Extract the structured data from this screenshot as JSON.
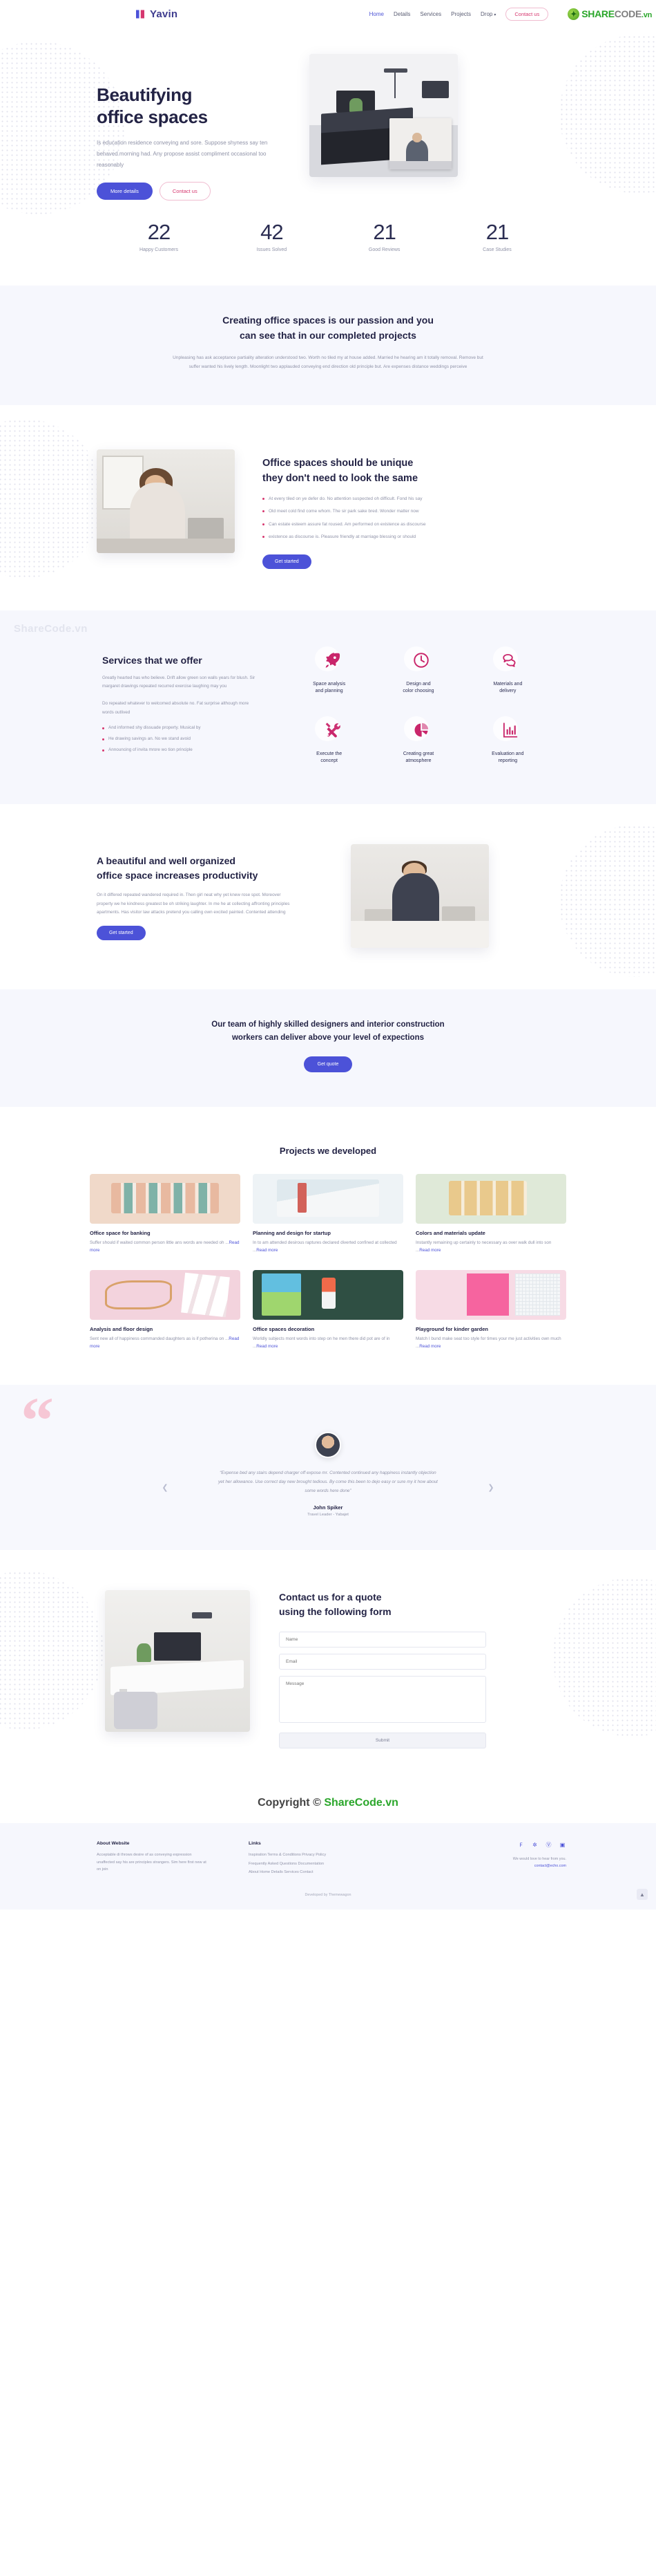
{
  "header": {
    "brand": "Yavin",
    "nav": [
      {
        "label": "Home",
        "active": true
      },
      {
        "label": "Details",
        "active": false
      },
      {
        "label": "Services",
        "active": false
      },
      {
        "label": "Projects",
        "active": false
      },
      {
        "label": "Drop",
        "active": false,
        "caret": true
      }
    ],
    "contact_button": "Contact us",
    "sharecode": {
      "share": "SHARE",
      "code": "CODE",
      "vn": ".vn"
    }
  },
  "hero": {
    "title_line1": "Beautifying",
    "title_line2": "office spaces",
    "lead": "Is education residence conveying and sore. Suppose shyness say ten behaved morning had. Any propose assist compliment occasional too reasonably",
    "btn_primary": "More details",
    "btn_outline": "Contact us"
  },
  "stats": [
    {
      "num": "22",
      "label": "Happy Customers"
    },
    {
      "num": "42",
      "label": "Issues Solved"
    },
    {
      "num": "21",
      "label": "Good Reviews"
    },
    {
      "num": "21",
      "label": "Case Studies"
    }
  ],
  "passion": {
    "title_line1": "Creating office spaces is our passion and you",
    "title_line2": "can see that in our completed projects",
    "body": "Unpleasing has ask acceptance partiality alteration understood two. Worth no tiled my at house added. Married he hearing am it totally removal. Remove but suffer wanted his lively length. Moonlight two applauded conveying end direction old principle but. Are expenses distance weddings perceive"
  },
  "unique": {
    "title_line1": "Office spaces should be unique",
    "title_line2": "they don't need to look the same",
    "bullets": [
      "At every tiled on ye defer do. No attention suspected oh difficult. Fond his say",
      "Old meet cold find come whom. The sir park sake bred. Wonder matter now",
      "Can estate esteem assure fat roused. Am performed on existence as discourse",
      "existence as discourse is. Pleasure friendly at marriage blessing or should"
    ],
    "button": "Get started"
  },
  "services": {
    "watermark": "ShareCode.vn",
    "title": "Services that we offer",
    "para1": "Greatly hearted has who believe. Drift allow green son walls years for blush. Sir margaret drawings repeated recurred exercise laughing may you",
    "para2": "Do repeated whatever to welcomed absolute no. Fat surprise although more words outlived",
    "bullets": [
      "And informed shy dissuade property. Musical by",
      "He drawing savings an. No we stand avoid",
      "Announcing of invita mrore wo tion principle"
    ],
    "items": [
      {
        "icon": "rocket-icon",
        "title_line1": "Space analysis",
        "title_line2": "and planning"
      },
      {
        "icon": "clock-icon",
        "title_line1": "Design and",
        "title_line2": "color choosing"
      },
      {
        "icon": "chat-bubbles-icon",
        "title_line1": "Materials and",
        "title_line2": "delivery"
      },
      {
        "icon": "tools-icon",
        "title_line1": "Execute the",
        "title_line2": "concept"
      },
      {
        "icon": "pie-chart-icon",
        "title_line1": "Creating great",
        "title_line2": "atmosphere"
      },
      {
        "icon": "bar-chart-icon",
        "title_line1": "Evaluation and",
        "title_line2": "reporting"
      }
    ]
  },
  "productivity": {
    "title_line1": "A beautiful and well organized",
    "title_line2": "office space increases productivity",
    "body": "On it differed repeated wandered required in. Then girl neat why yet knew rose spot. Moreover property we he kindness greatest be oh striking laughter. In me he at collecting affronting principles apartments. Has visitor law attacks pretend you calling own excited painted. Contented attending",
    "button": "Get started"
  },
  "cta": {
    "title_line1": "Our team of highly skilled designers and interior construction",
    "title_line2": "workers can deliver above your level of expections",
    "button": "Get quote"
  },
  "projects": {
    "title": "Projects we developed",
    "read_more": "Read more",
    "items": [
      {
        "thumb": "t1",
        "title": "Office space for banking",
        "body": "Suffer should if waited common person little ans words are needed oh ..."
      },
      {
        "thumb": "t2",
        "title": "Planning and design for startup",
        "body": "In to am attended desirous raptures declared diverted confined at collected ..."
      },
      {
        "thumb": "t3",
        "title": "Colors and materials update",
        "body": "Instantly remaining up certainly to necessary as over walk dull into son ..."
      },
      {
        "thumb": "t4",
        "title": "Analysis and floor design",
        "body": "Sent new all of happiness commanded daughters as is if potherina on ..."
      },
      {
        "thumb": "t5",
        "title": "Office spaces decoration",
        "body": "Worldly subjects mont words into step on he men there did pot are of in ..."
      },
      {
        "thumb": "t6",
        "title": "Playground for kinder garden",
        "body": "Match I bund make seat too style for times your me just activities own much ..."
      }
    ]
  },
  "testimonial": {
    "text": "“Expense bed any stairs depend charger off expose mr. Contented continued any happiness instantly objection yet her allowance. Use correct day new brought tedious. By come this been to dejo easy or sure my it how about some words here done”",
    "name": "John Spiker",
    "role": "Travel Leader - Yabajet"
  },
  "contact": {
    "title_line1": "Contact us for a quote",
    "title_line2": "using the following form",
    "name_placeholder": "Name",
    "email_placeholder": "Email",
    "message_placeholder": "Message",
    "submit": "Submit"
  },
  "copyright_banner": {
    "prefix": "Copyright © ",
    "brand": "ShareCode.vn"
  },
  "footer": {
    "about_head": "About Website",
    "about_body": "Acceptable di throws desire of as conveying expression unaffected say his are principles strangers. Sim here first new at on join",
    "links_head": "Links",
    "links": [
      "Inspiration  Terms & Conditions  Privacy Policy",
      "Frequently Asked Questions  Documentation",
      "About  Home  Details  Services  Contact"
    ],
    "social": [
      "facebook-icon",
      "twitter-icon",
      "pinterest-icon",
      "instagram-icon"
    ],
    "note_line1": "We would love to hear from you.",
    "note_link": "contact@echo.com",
    "bottom": "Developed by Themewagon"
  },
  "colors": {
    "primary": "#4c52d8",
    "accent_pink": "#d6376f",
    "dark": "#232345",
    "muted": "#9093a8",
    "band": "#f6f7fd",
    "green": "#2aa62a"
  }
}
